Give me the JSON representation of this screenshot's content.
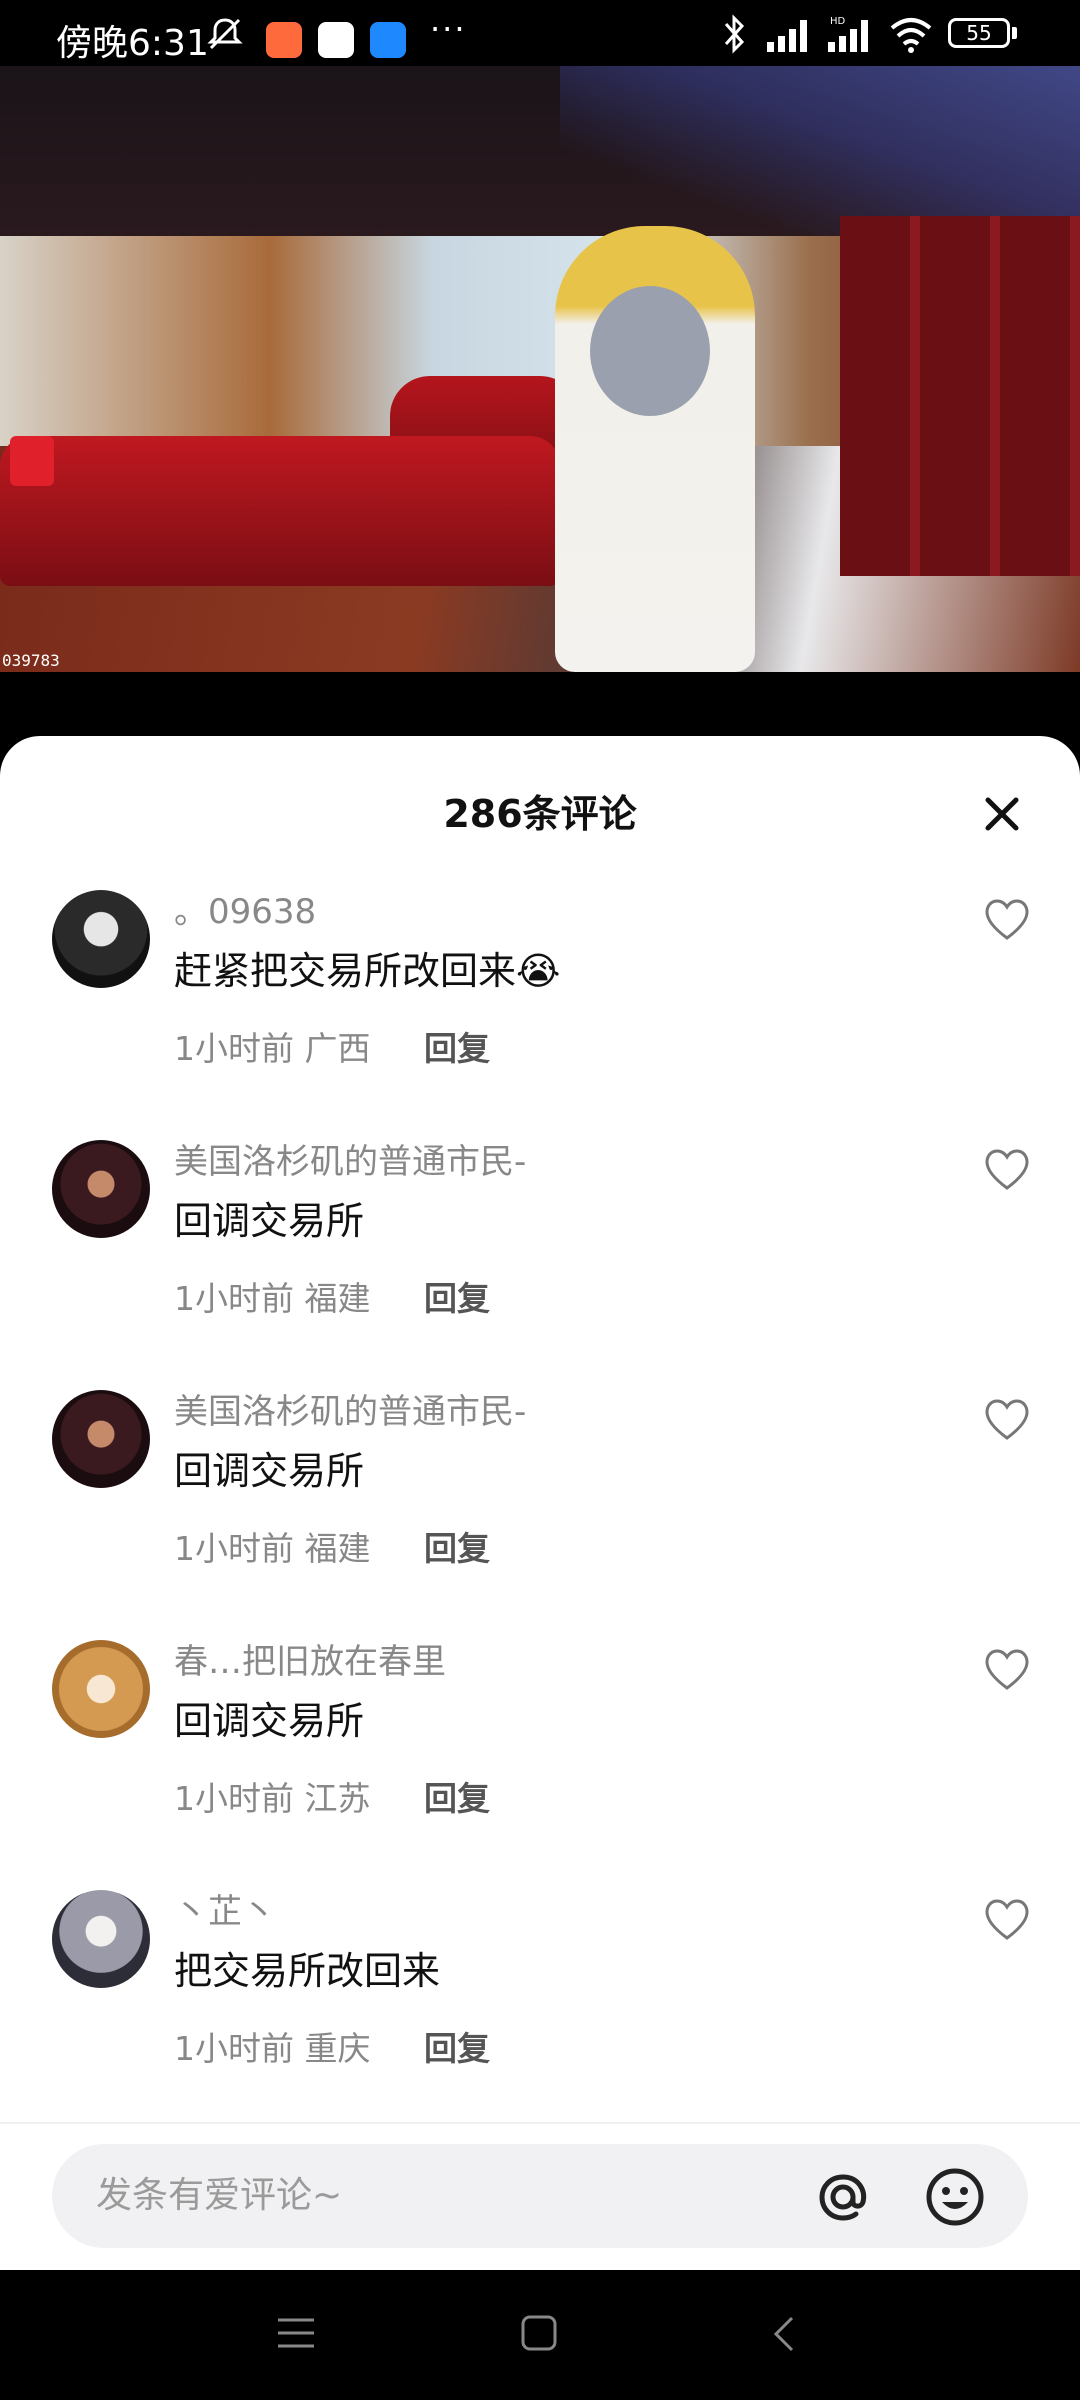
{
  "status_bar": {
    "time": "傍晚6:31",
    "battery": "55",
    "icons": [
      "mute-icon",
      "app-badge",
      "baidu-icon",
      "chat-icon",
      "more-icon",
      "bluetooth-icon",
      "signal-icon",
      "hd-signal-icon",
      "wifi-icon",
      "battery-icon"
    ]
  },
  "video": {
    "id_label": "039783"
  },
  "comments_sheet": {
    "title": "286条评论",
    "reply_label": "回复",
    "comments": [
      {
        "user": "。09638",
        "text": "赶紧把交易所改回来😭",
        "time": "1小时前",
        "location": "广西"
      },
      {
        "user": "美国洛杉矶的普通市民-",
        "text": "回调交易所",
        "time": "1小时前",
        "location": "福建"
      },
      {
        "user": "美国洛杉矶的普通市民-",
        "text": "回调交易所",
        "time": "1小时前",
        "location": "福建"
      },
      {
        "user": "春…把旧放在春里",
        "text": "回调交易所",
        "time": "1小时前",
        "location": "江苏"
      },
      {
        "user": "丶芷丶",
        "text": "把交易所改回来",
        "time": "1小时前",
        "location": "重庆"
      }
    ],
    "input_placeholder": "发条有爱评论~"
  }
}
